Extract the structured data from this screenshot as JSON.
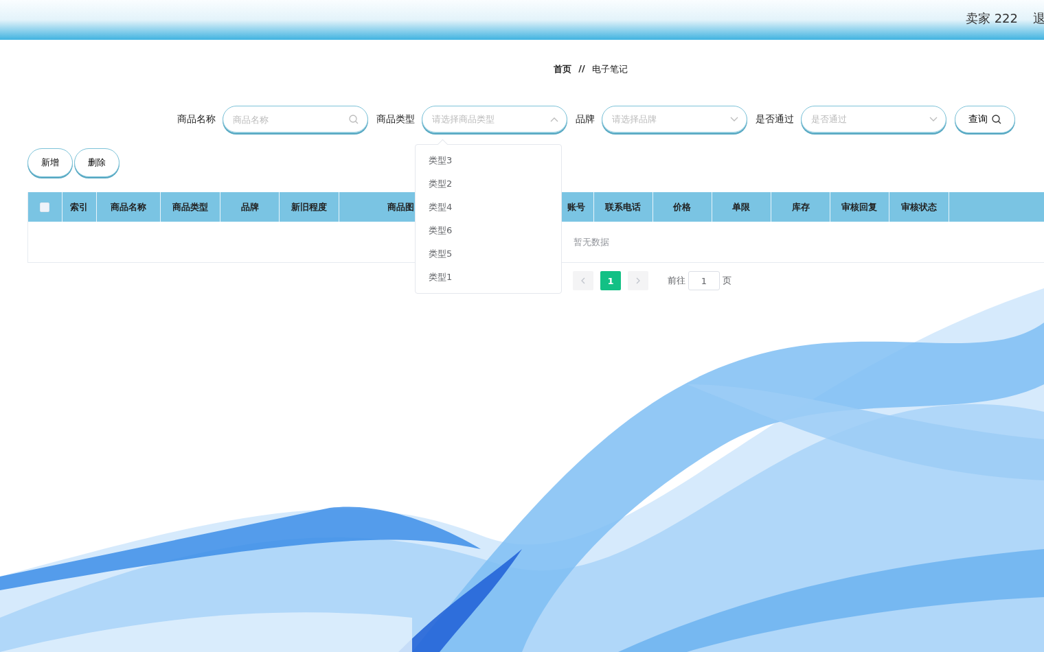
{
  "header": {
    "user": "卖家 222",
    "logout": "退"
  },
  "breadcrumb": {
    "separator": "//",
    "items": [
      {
        "label": "首页",
        "current": false
      },
      {
        "label": "电子笔记",
        "current": true
      }
    ]
  },
  "search": {
    "fields": [
      {
        "kind": "input",
        "label": "商品名称",
        "placeholder": "商品名称"
      },
      {
        "kind": "select",
        "label": "商品类型",
        "placeholder": "请选择商品类型",
        "expanded": true
      },
      {
        "kind": "select",
        "label": "品牌",
        "placeholder": "请选择品牌",
        "expanded": false
      },
      {
        "kind": "select",
        "label": "是否通过",
        "placeholder": "是否通过",
        "expanded": false
      }
    ],
    "button": "查询"
  },
  "dropdown": {
    "options": [
      {
        "label": "类型3",
        "selected": false
      },
      {
        "label": "类型2",
        "selected": false
      },
      {
        "label": "类型4",
        "selected": false
      },
      {
        "label": "类型6",
        "selected": false
      },
      {
        "label": "类型5",
        "selected": false
      },
      {
        "label": "类型1",
        "selected": false
      }
    ]
  },
  "actions": [
    "新增",
    "删除"
  ],
  "table": {
    "select_all_checked": false,
    "columns": [
      "索引",
      "商品名称",
      "商品类型",
      "品牌",
      "新旧程度",
      "商品图",
      "账号",
      "联系电话",
      "价格",
      "单限",
      "库存",
      "审核回复",
      "审核状态"
    ],
    "empty_text": "暂无数据"
  },
  "pagination": {
    "pages": [
      {
        "label": "1",
        "selected": true
      }
    ],
    "goto_label": "前往",
    "goto_value": "1",
    "page_suffix": "页"
  }
}
